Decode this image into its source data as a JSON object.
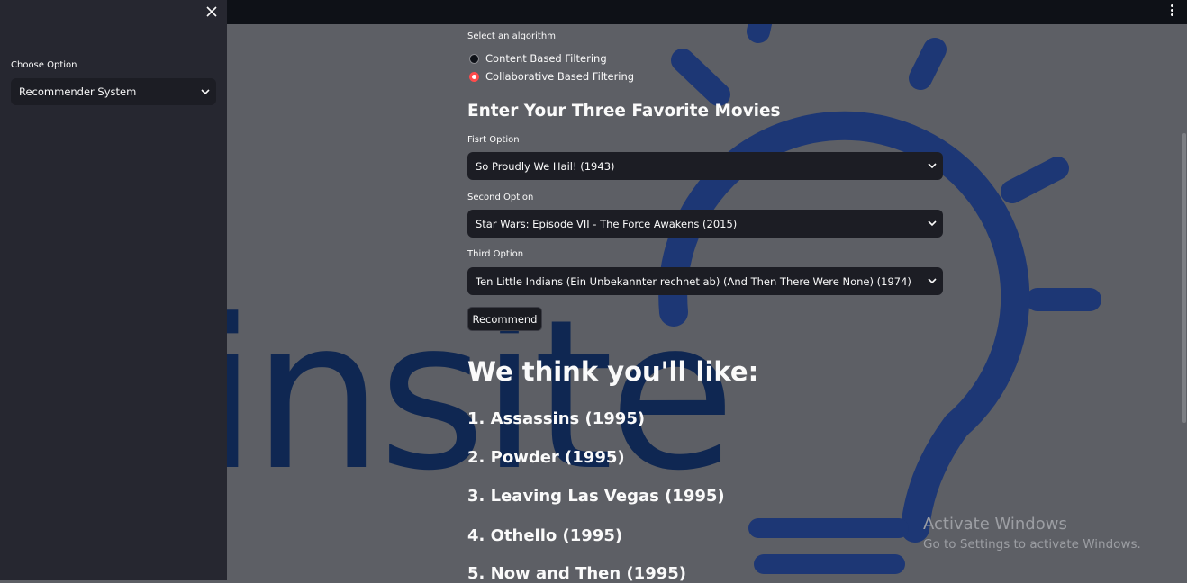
{
  "sidebar": {
    "choose_label": "Choose Option",
    "choose_value": "Recommender System"
  },
  "main": {
    "algorithm_label": "Select an algorithm",
    "algorithms": [
      {
        "label": "Content Based Filtering",
        "selected": false
      },
      {
        "label": "Collaborative Based Filtering",
        "selected": true
      }
    ],
    "heading": "Enter Your Three Favorite Movies",
    "first_label": "Fisrt Option",
    "first_value": "So Proudly We Hail! (1943)",
    "second_label": "Second Option",
    "second_value": "Star Wars: Episode VII - The Force Awakens (2015)",
    "third_label": "Third Option",
    "third_value": "Ten Little Indians (Ein Unbekannter rechnet ab) (And Then There Were None) (1974)",
    "recommend_label": "Recommend",
    "results_heading": "We think you'll like:",
    "recommendations": [
      "1. Assassins (1995)",
      "2. Powder (1995)",
      "3. Leaving Las Vegas (1995)",
      "4. Othello (1995)",
      "5. Now and Then (1995)"
    ]
  },
  "watermark": {
    "text": "insite"
  },
  "os_overlay": {
    "title": "Activate Windows",
    "subtitle": "Go to Settings to activate Windows."
  },
  "colors": {
    "sidebar_bg": "#262730",
    "main_bg": "#5d5f65",
    "accent": "#ff4b4b",
    "watermark": "#1d3775"
  },
  "icons": [
    "close-icon",
    "kebab-menu-icon",
    "chevron-down-icon",
    "lightbulb-logo"
  ]
}
